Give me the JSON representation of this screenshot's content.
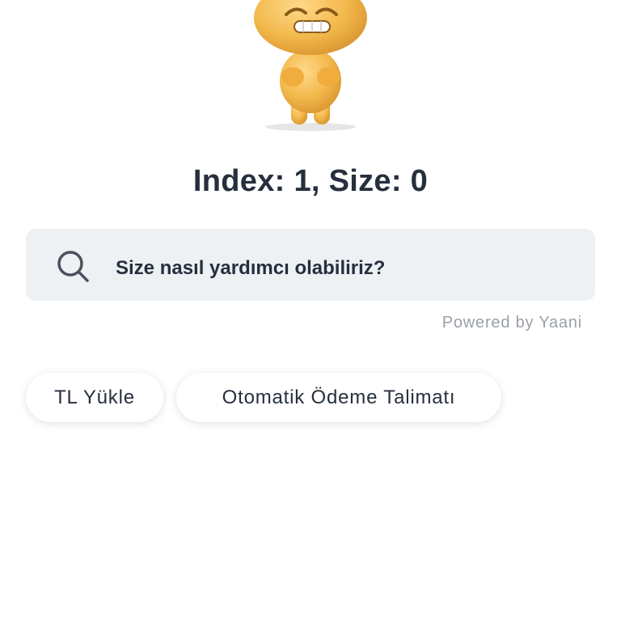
{
  "mascot": {
    "icon": "worried-mascot-character"
  },
  "status": {
    "title": "Index: 1, Size: 0"
  },
  "search": {
    "icon": "search-icon",
    "placeholder": "Size nasıl yardımcı olabiliriz?"
  },
  "powered_by": "Powered by Yaani",
  "quick_actions": [
    {
      "label": "TL Yükle"
    },
    {
      "label": "Otomatik Ödeme Talimatı"
    }
  ],
  "colors": {
    "text_primary": "#262f3d",
    "search_bg": "#eef1f4",
    "muted": "#9aa0a8",
    "mascot": "#f2b84b"
  }
}
